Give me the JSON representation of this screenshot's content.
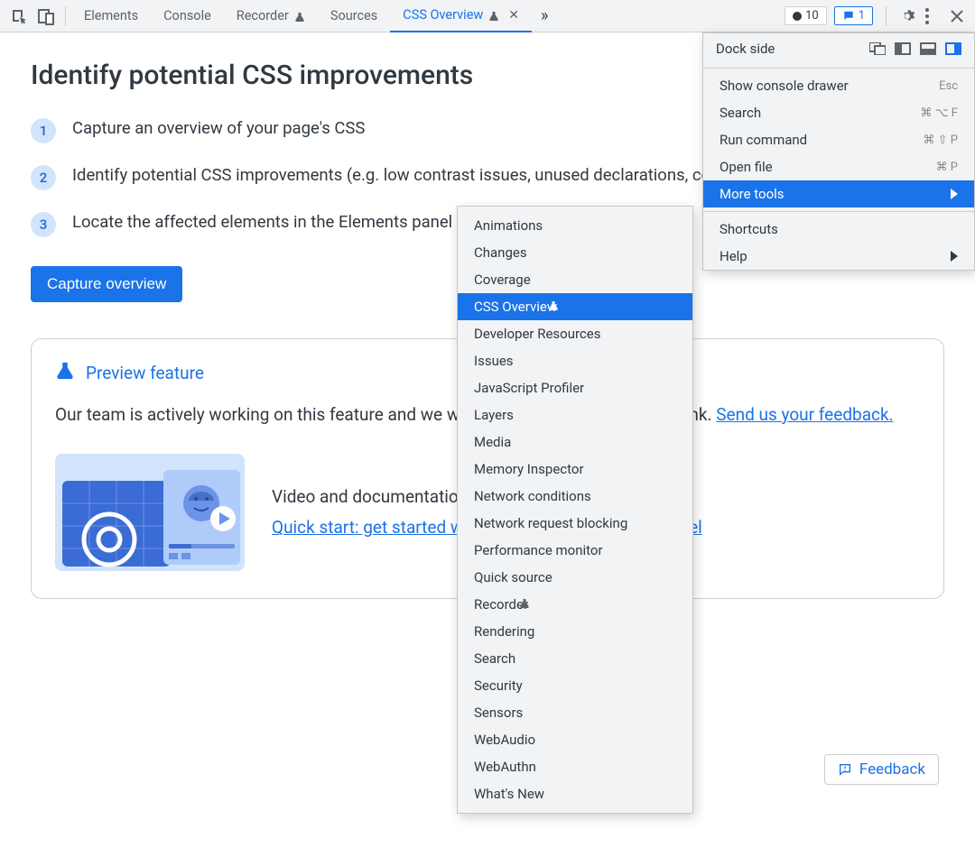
{
  "tabs": {
    "t0": "Elements",
    "t1": "Console",
    "t2": "Recorder",
    "t3": "Sources",
    "t4": "CSS Overview"
  },
  "status": {
    "errors": "10",
    "messages": "1"
  },
  "page": {
    "title": "Identify potential CSS improvements",
    "steps": [
      "Capture an overview of your page's CSS",
      "Identify potential CSS improvements (e.g. low contrast issues, unused declarations, color or font mismatches)",
      "Locate the affected elements in the Elements panel"
    ],
    "btn": "Capture overview"
  },
  "preview": {
    "heading": "Preview feature",
    "text_pre": "Our team is actively working on this feature and we would love to know what you think. ",
    "link1": "Send us your feedback.",
    "vid_lead": "Video and documentation",
    "vid_link": "Quick start: get started with the new CSS Overview panel"
  },
  "feedback_btn": "Feedback",
  "menu_main": {
    "dock": "Dock side",
    "i0": "Show console drawer",
    "s0": "Esc",
    "i1": "Search",
    "s1": "⌘ ⌥ F",
    "i2": "Run command",
    "s2": "⌘ ⇧ P",
    "i3": "Open file",
    "s3": "⌘ P",
    "i4": "More tools",
    "i5": "Shortcuts",
    "i6": "Help"
  },
  "menu_more": [
    "Animations",
    "Changes",
    "Coverage",
    "CSS Overview",
    "Developer Resources",
    "Issues",
    "JavaScript Profiler",
    "Layers",
    "Media",
    "Memory Inspector",
    "Network conditions",
    "Network request blocking",
    "Performance monitor",
    "Quick source",
    "Recorder",
    "Rendering",
    "Search",
    "Security",
    "Sensors",
    "WebAudio",
    "WebAuthn",
    "What's New"
  ]
}
